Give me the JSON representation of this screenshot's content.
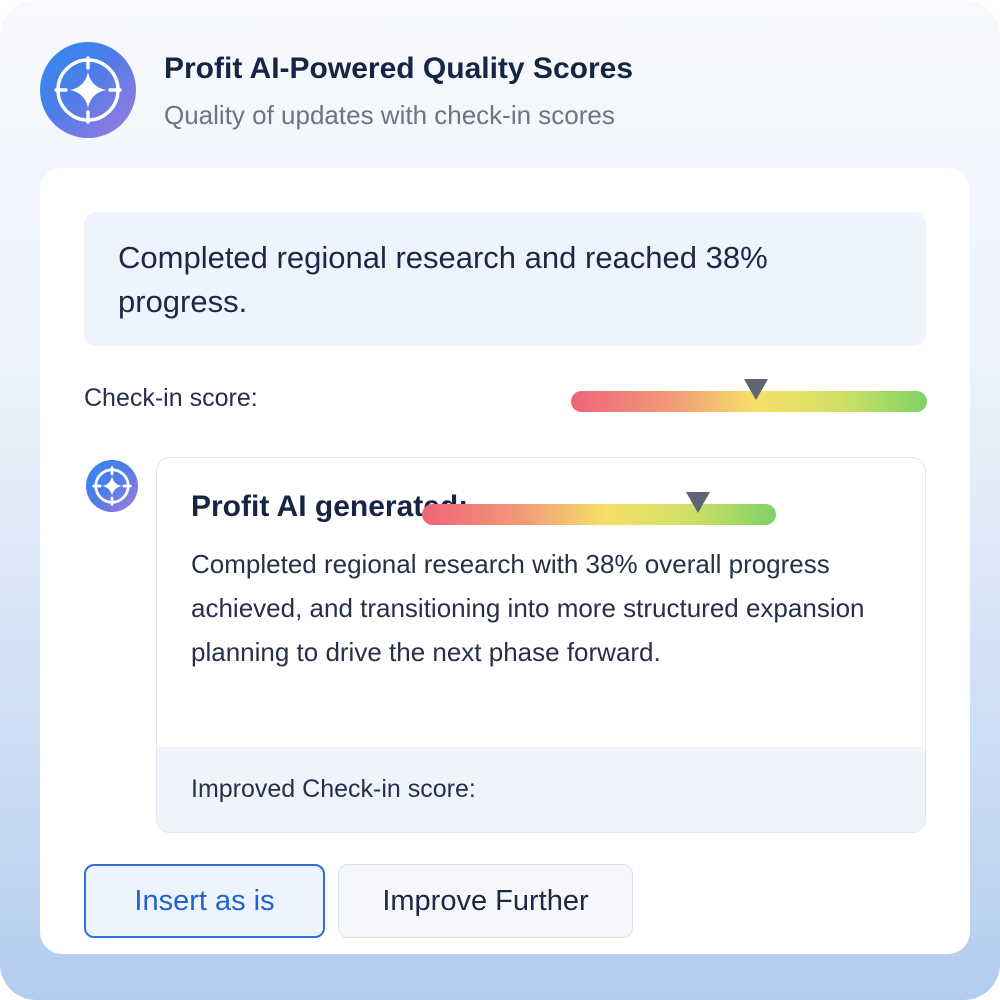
{
  "header": {
    "title": "Profit AI-Powered Quality Scores",
    "subtitle": "Quality of updates with check-in scores",
    "logo_icon": "sparkle-crosshair-icon"
  },
  "update": {
    "text": "Completed regional research and reached 38% progress."
  },
  "checkin": {
    "label": "Check-in score:",
    "score_fraction": 0.52
  },
  "ai_suggestion": {
    "avatar_icon": "sparkle-crosshair-icon",
    "heading": "Profit AI generated:",
    "text": "Completed regional research with 38% overall progress achieved, and transitioning into more structured expansion planning to drive the next phase forward.",
    "improved_label": "Improved Check-in score:",
    "improved_score_fraction": 0.78
  },
  "actions": {
    "insert_label": "Insert as is",
    "improve_label": "Improve Further"
  },
  "colors": {
    "accent": "#2163cc",
    "logo_gradient_start": "#2f8cf0",
    "logo_gradient_end": "#a37be0",
    "score_low": "#ef6478",
    "score_mid": "#f6e068",
    "score_high": "#7fd269",
    "marker": "#5d6573"
  }
}
